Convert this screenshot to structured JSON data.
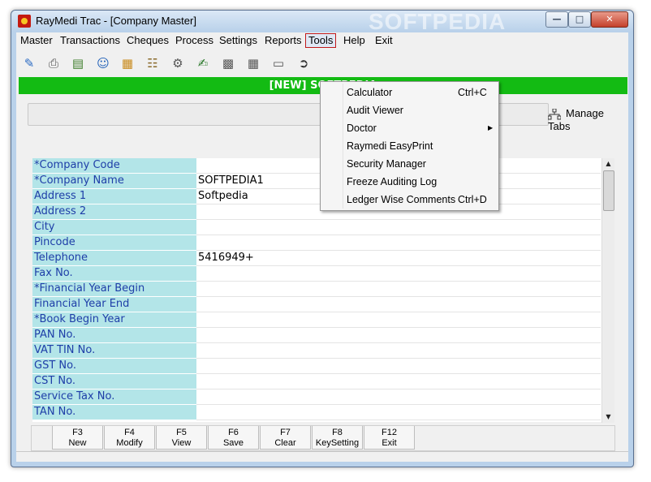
{
  "window": {
    "title": "RayMedi Trac - [Company Master]",
    "watermark": "SOFTPEDIA",
    "min_glyph": "—",
    "max_glyph": "□",
    "close_glyph": "✕"
  },
  "menubar": {
    "items": [
      "Master",
      "Transactions",
      "Cheques",
      "Process",
      "Settings",
      "Reports",
      "Tools",
      "Help",
      "Exit"
    ],
    "active": "Tools"
  },
  "toolbar": {
    "icons": [
      "book-icon",
      "printer-icon",
      "report-icon",
      "users-icon",
      "boxes-icon",
      "document-icon",
      "settings-icon",
      "edit-icon",
      "chart-icon",
      "calendar-icon",
      "card-icon",
      "exit-icon"
    ]
  },
  "banner": {
    "text": "[NEW] SOFTPEDIA"
  },
  "manage_tabs": {
    "label": "Manage Tabs"
  },
  "form": {
    "rows": [
      {
        "label": "*Company Code",
        "value": ""
      },
      {
        "label": "*Company Name",
        "value": "SOFTPEDIA1"
      },
      {
        "label": " Address 1",
        "value": "Softpedia"
      },
      {
        "label": " Address 2",
        "value": ""
      },
      {
        "label": " City",
        "value": ""
      },
      {
        "label": " Pincode",
        "value": ""
      },
      {
        "label": " Telephone",
        "value": "5416949+"
      },
      {
        "label": " Fax No.",
        "value": ""
      },
      {
        "label": "*Financial Year Begin",
        "value": ""
      },
      {
        "label": " Financial Year End",
        "value": ""
      },
      {
        "label": "*Book Begin Year",
        "value": ""
      },
      {
        "label": " PAN No.",
        "value": ""
      },
      {
        "label": " VAT TIN No.",
        "value": ""
      },
      {
        "label": " GST No.",
        "value": ""
      },
      {
        "label": " CST No.",
        "value": ""
      },
      {
        "label": " Service Tax No.",
        "value": ""
      },
      {
        "label": " TAN No.",
        "value": ""
      }
    ]
  },
  "function_keys": [
    {
      "key": "F3",
      "label": "New"
    },
    {
      "key": "F4",
      "label": "Modify"
    },
    {
      "key": "F5",
      "label": "View"
    },
    {
      "key": "F6",
      "label": "Save"
    },
    {
      "key": "F7",
      "label": "Clear"
    },
    {
      "key": "F8",
      "label": "KeySetting"
    },
    {
      "key": "F12",
      "label": "Exit"
    }
  ],
  "tools_menu": {
    "items": [
      {
        "label": "Calculator",
        "shortcut": "Ctrl+C",
        "submenu": false
      },
      {
        "label": "Audit Viewer",
        "shortcut": "",
        "submenu": false
      },
      {
        "label": "Doctor",
        "shortcut": "",
        "submenu": true
      },
      {
        "label": "Raymedi EasyPrint",
        "shortcut": "",
        "submenu": false
      },
      {
        "label": "Security Manager",
        "shortcut": "",
        "submenu": false
      },
      {
        "label": "Freeze Auditing Log",
        "shortcut": "",
        "submenu": false
      },
      {
        "label": "Ledger Wise Comments",
        "shortcut": "Ctrl+D",
        "submenu": false
      }
    ]
  },
  "colors": {
    "banner": "#13bb13",
    "label_bg": "#b3e5e8",
    "label_text": "#1e3ea8",
    "active_menu_border": "#c0191b"
  }
}
